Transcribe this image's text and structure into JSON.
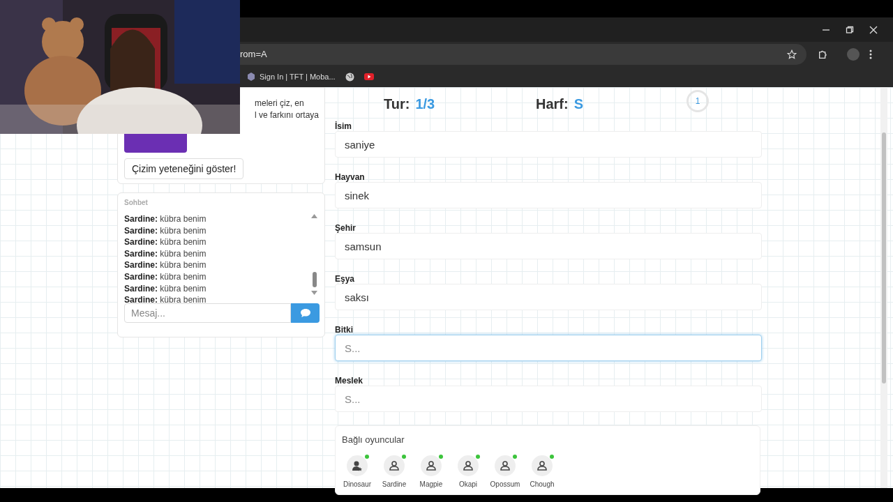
{
  "browser": {
    "address": "rom=A",
    "bookmarks": [
      {
        "kind": "site",
        "label": "Sign In | TFT | Moba..."
      },
      {
        "kind": "globe"
      },
      {
        "kind": "video"
      }
    ]
  },
  "intro": {
    "lines": [
      "meleri çiz, en",
      "l ve farkını ortaya"
    ],
    "button": "Çizim yeteneğini göster!"
  },
  "chat": {
    "title": "Sohbet",
    "messages": [
      {
        "user": "Sardine:",
        "text": "kübra benim"
      },
      {
        "user": "Sardine:",
        "text": "kübra benim"
      },
      {
        "user": "Sardine:",
        "text": "kübra benim"
      },
      {
        "user": "Sardine:",
        "text": "kübra benim"
      },
      {
        "user": "Sardine:",
        "text": "kübra benim"
      },
      {
        "user": "Sardine:",
        "text": "kübra benim"
      },
      {
        "user": "Sardine:",
        "text": "kübra benim"
      },
      {
        "user": "Sardine:",
        "text": "kübra benim"
      }
    ],
    "placeholder": "Mesaj..."
  },
  "game": {
    "round_label": "Tur:",
    "round": "1/3",
    "letter_label": "Harf:",
    "letter": "S",
    "timer": "1"
  },
  "fields": [
    {
      "label": "İsim",
      "value": "saniye",
      "focused": false
    },
    {
      "label": "Hayvan",
      "value": "sinek",
      "focused": false
    },
    {
      "label": "Şehir",
      "value": "samsun",
      "focused": false
    },
    {
      "label": "Eşya",
      "value": "saksı",
      "focused": false
    },
    {
      "label": "Bitki",
      "placeholder": "S...",
      "focused": true
    },
    {
      "label": "Meslek",
      "placeholder": "S...",
      "focused": false
    }
  ],
  "players": {
    "title": "Bağlı oyuncular",
    "items": [
      {
        "name": "Dinosaur",
        "host": true,
        "online": true
      },
      {
        "name": "Sardine",
        "host": false,
        "online": true
      },
      {
        "name": "Magpie",
        "host": false,
        "online": true
      },
      {
        "name": "Okapi",
        "host": false,
        "online": true
      },
      {
        "name": "Opossum",
        "host": false,
        "online": true
      },
      {
        "name": "Chough",
        "host": false,
        "online": true
      }
    ]
  }
}
